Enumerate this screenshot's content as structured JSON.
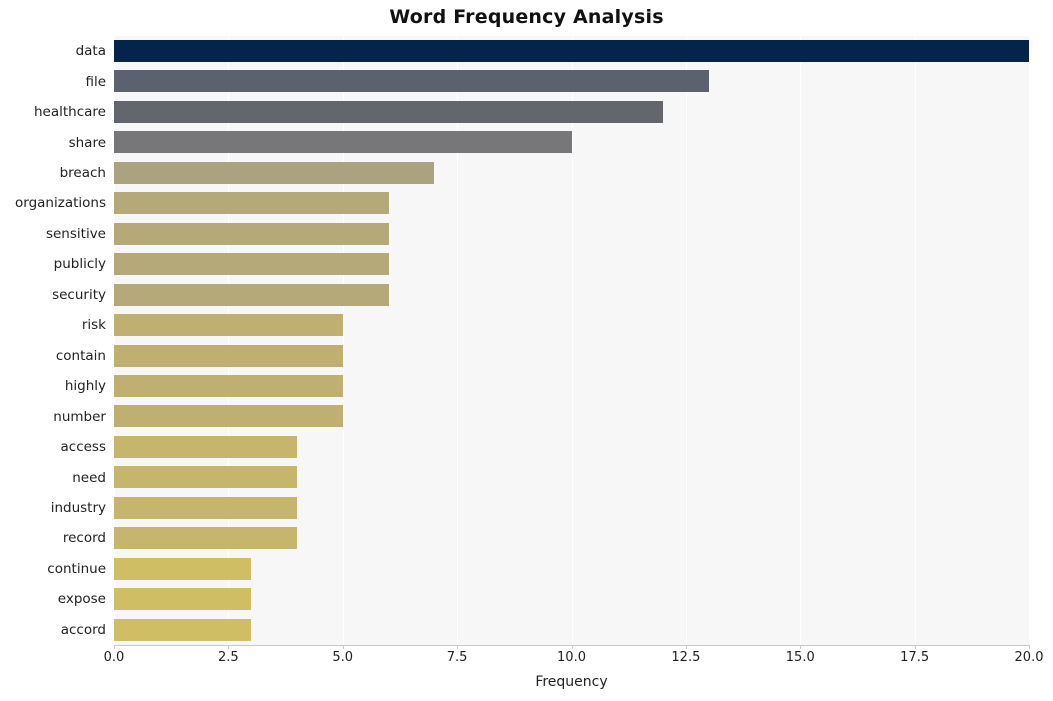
{
  "chart_data": {
    "type": "bar",
    "orientation": "horizontal",
    "title": "Word Frequency Analysis",
    "xlabel": "Frequency",
    "ylabel": "",
    "xlim": [
      0,
      20
    ],
    "xticks": [
      "0.0",
      "2.5",
      "5.0",
      "7.5",
      "10.0",
      "12.5",
      "15.0",
      "17.5",
      "20.0"
    ],
    "xtick_values": [
      0,
      2.5,
      5,
      7.5,
      10,
      12.5,
      15,
      17.5,
      20
    ],
    "grid": true,
    "grid_axis": "x",
    "legend": "none",
    "plot_background": "#f7f7f7",
    "categories": [
      "data",
      "file",
      "healthcare",
      "share",
      "breach",
      "organizations",
      "sensitive",
      "publicly",
      "security",
      "risk",
      "contain",
      "highly",
      "number",
      "access",
      "need",
      "industry",
      "record",
      "continue",
      "expose",
      "accord"
    ],
    "values": [
      20,
      13,
      12,
      10,
      7,
      6,
      6,
      6,
      6,
      5,
      5,
      5,
      5,
      4,
      4,
      4,
      4,
      3,
      3,
      3
    ],
    "bar_colors": [
      "#04244b",
      "#5b616e",
      "#63666d",
      "#77777a",
      "#aba380",
      "#b6a979",
      "#b6a979",
      "#b6a979",
      "#b6a979",
      "#bfb072",
      "#bfb072",
      "#bfb072",
      "#bfb072",
      "#c6b66d",
      "#c6b66d",
      "#c6b66d",
      "#c6b66d",
      "#cfbe63",
      "#cfbe63",
      "#cfbe63"
    ]
  }
}
